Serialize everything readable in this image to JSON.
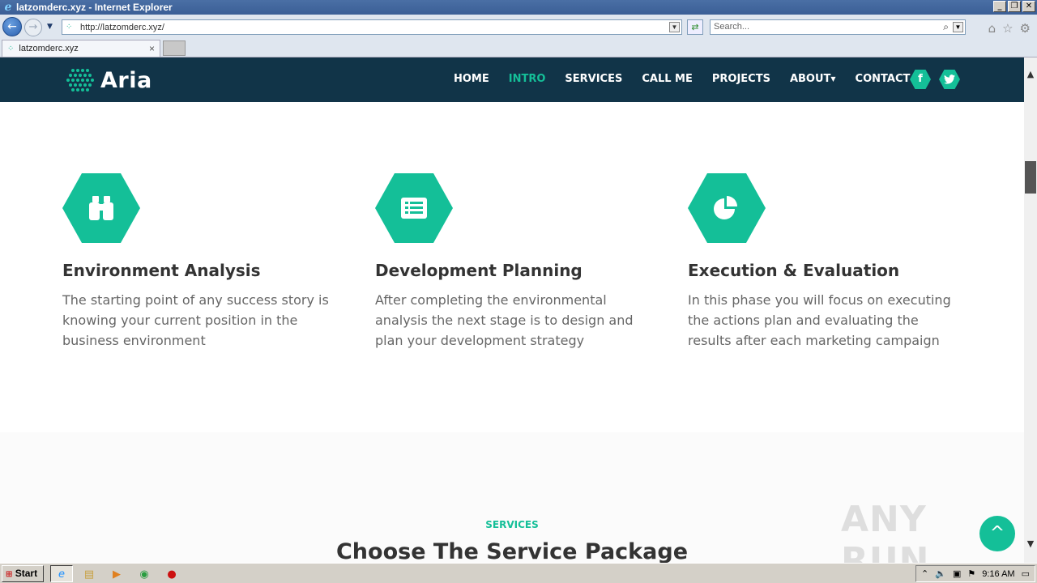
{
  "window": {
    "title": "latzomderc.xyz - Internet Explorer",
    "ie_logo": "e",
    "minimize": "_",
    "restore": "❐",
    "close": "✕"
  },
  "browser": {
    "back_icon": "←",
    "forward_icon": "→",
    "address": "http://latzomderc.xyz/",
    "search_placeholder": "Search...",
    "tab_label": "latzomderc.xyz",
    "tab_close": "×",
    "home_icon": "⌂",
    "favorites_icon": "☆",
    "tools_icon": "⚙"
  },
  "site": {
    "logo_text": "Aria",
    "nav": {
      "home": "HOME",
      "intro": "INTRO",
      "services": "SERVICES",
      "call_me": "CALL ME",
      "projects": "PROJECTS",
      "about": "ABOUT",
      "contact": "CONTACT"
    },
    "social": {
      "facebook": "f",
      "twitter": "t"
    },
    "accent_color": "#14bf98",
    "nav_bg_color": "#113448",
    "features": [
      {
        "icon": "binoculars-icon",
        "title": "Environment Analysis",
        "text": "The starting point of any success story is knowing your current position in the business environment"
      },
      {
        "icon": "list-icon",
        "title": "Development Planning",
        "text": "After completing the environmental analysis the next stage is to design and plan your development strategy"
      },
      {
        "icon": "pie-chart-icon",
        "title": "Execution & Evaluation",
        "text": "In this phase you will focus on executing the actions plan and evaluating the results after each marketing campaign"
      }
    ],
    "services_label": "SERVICES",
    "services_title": "Choose The Service Package",
    "back_to_top": "^"
  },
  "watermark": "ANY RUN",
  "taskbar": {
    "start": "Start",
    "clock": "9:16 AM"
  }
}
